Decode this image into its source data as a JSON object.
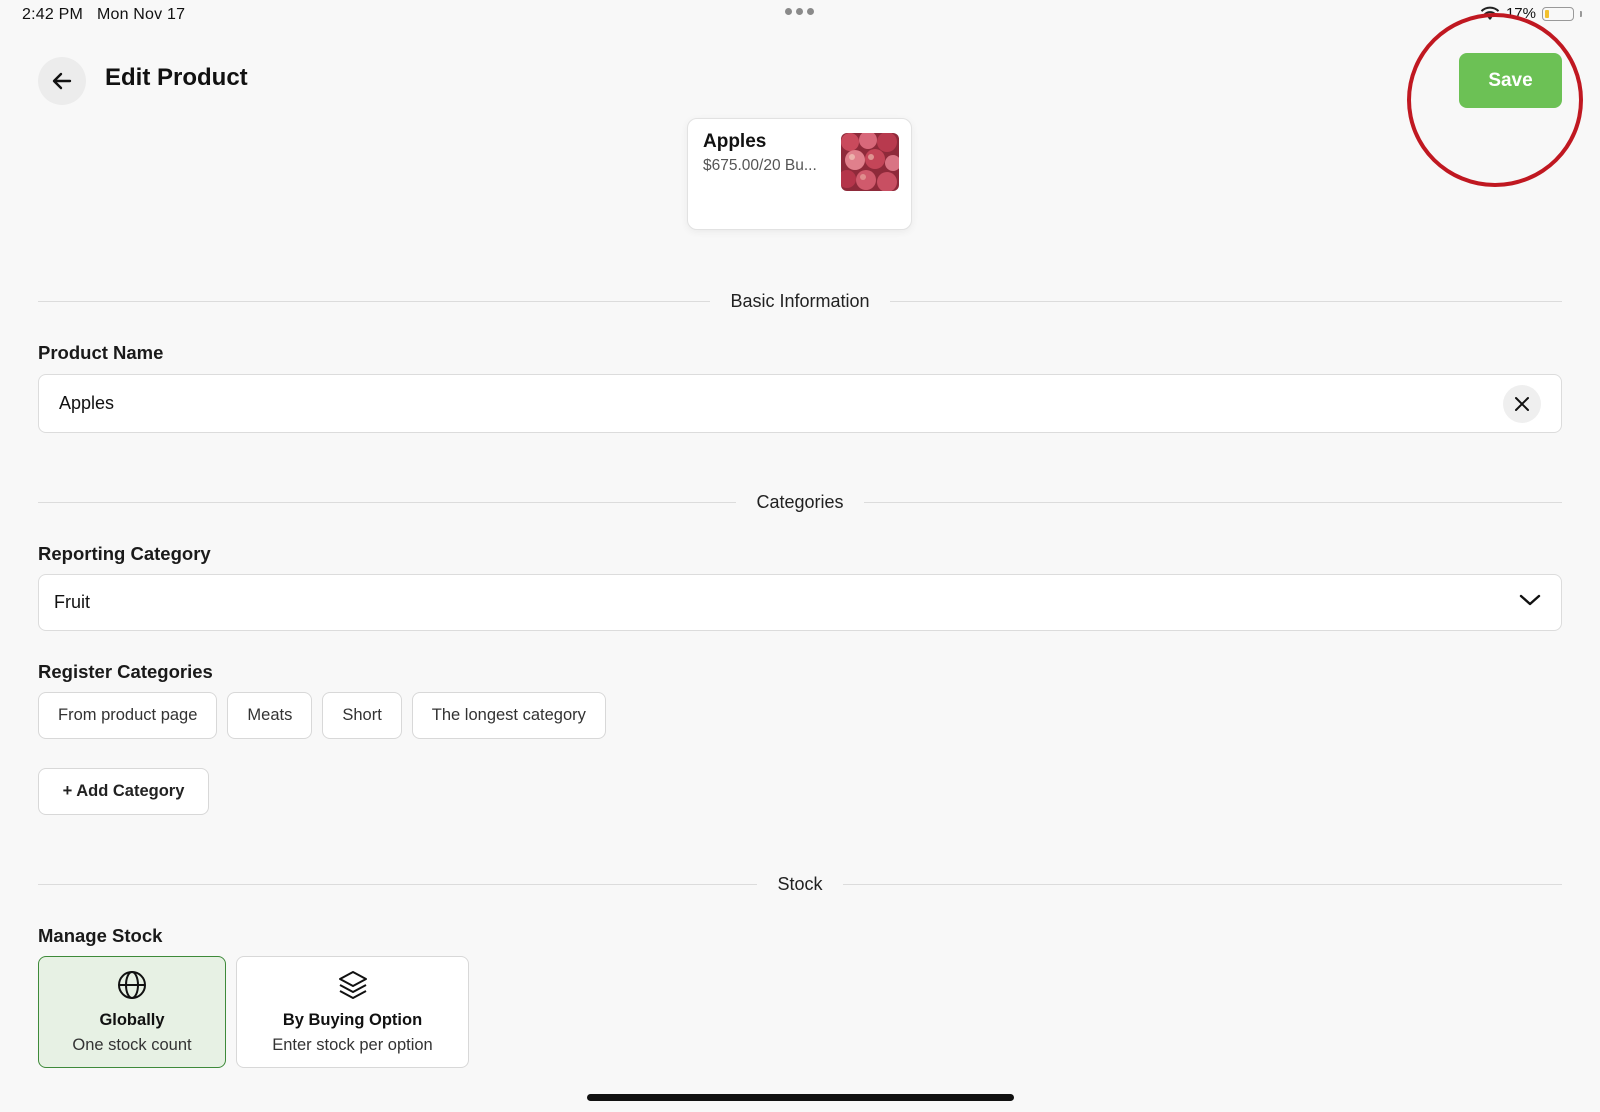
{
  "status_bar": {
    "time": "2:42 PM",
    "date": "Mon Nov 17",
    "battery_percent": "17%",
    "battery_level": 0.17,
    "wifi_icon": "wifi-icon",
    "battery_color": "#f2c12e"
  },
  "header": {
    "title": "Edit Product",
    "back_icon": "arrow-left-icon",
    "save_label": "Save",
    "save_color": "#6cc155"
  },
  "preview": {
    "name": "Apples",
    "price": "$675.00/20 Bu...",
    "image_icon": "apples-thumbnail"
  },
  "sections": {
    "basic_information": "Basic Information",
    "categories": "Categories",
    "stock": "Stock"
  },
  "product_name": {
    "label": "Product Name",
    "value": "Apples",
    "clear_icon": "close-icon"
  },
  "reporting_category": {
    "label": "Reporting Category",
    "value": "Fruit",
    "chevron_icon": "chevron-down-icon"
  },
  "register_categories": {
    "label": "Register Categories",
    "chips": [
      "From product page",
      "Meats",
      "Short",
      "The longest category"
    ],
    "add_label": "+ Add Category"
  },
  "manage_stock": {
    "label": "Manage Stock",
    "options": [
      {
        "title": "Globally",
        "subtitle": "One stock count",
        "icon": "globe-icon",
        "selected": true
      },
      {
        "title": "By Buying Option",
        "subtitle": "Enter stock per option",
        "icon": "layers-icon",
        "selected": false
      }
    ]
  },
  "colors": {
    "highlight_circle": "#c01821",
    "selected_option_bg": "#e7f1e4",
    "selected_option_border": "#3e8a3a"
  }
}
